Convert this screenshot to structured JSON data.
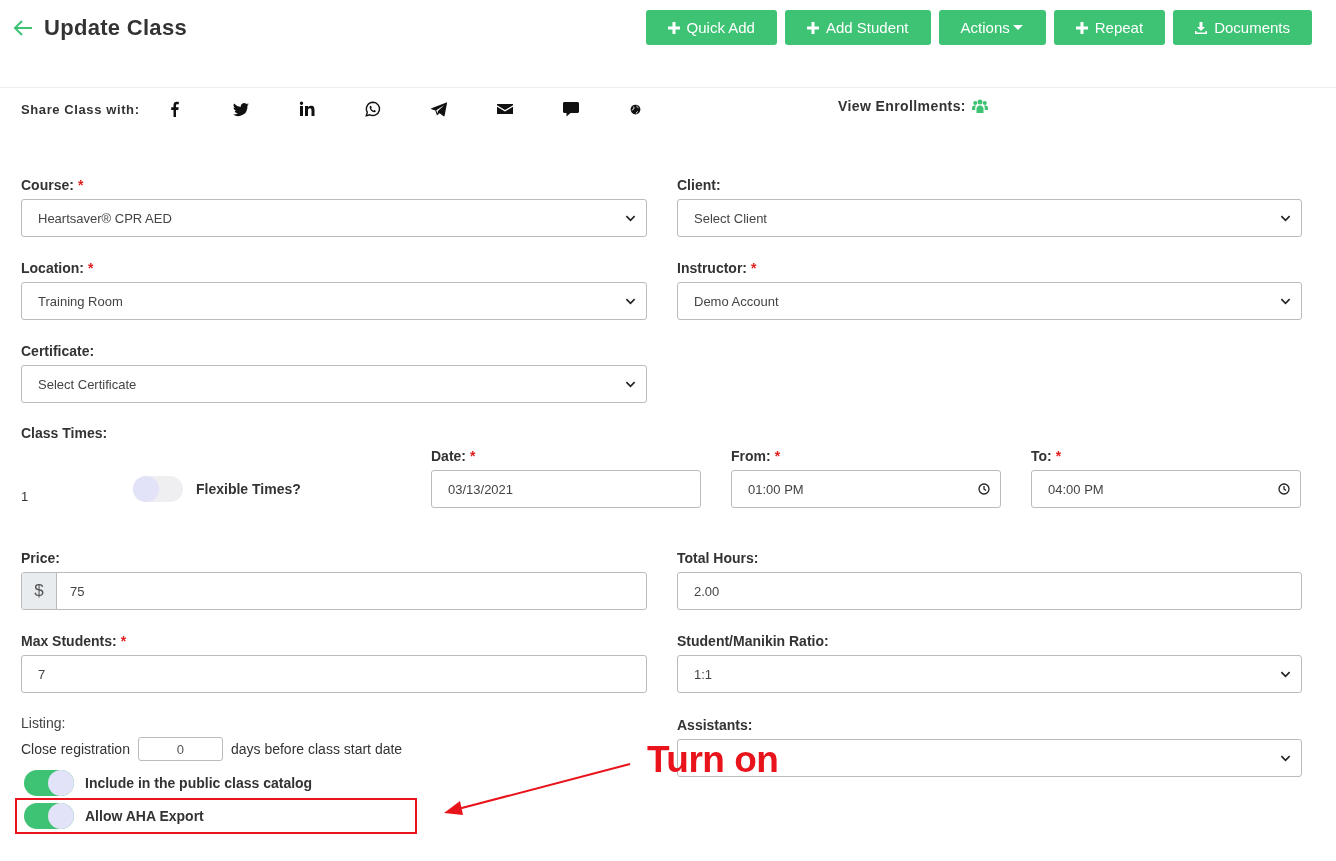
{
  "header": {
    "title": "Update Class",
    "buttons": [
      {
        "label": "Quick Add",
        "kind": "add"
      },
      {
        "label": "Add Student",
        "kind": "add"
      },
      {
        "label": "Actions",
        "kind": "dropdown"
      },
      {
        "label": "Repeat",
        "kind": "add"
      },
      {
        "label": "Documents",
        "kind": "download"
      }
    ]
  },
  "share": {
    "label": "Share Class with:",
    "services": [
      {
        "kind": "facebook"
      },
      {
        "kind": "twitter"
      },
      {
        "kind": "linkedin"
      },
      {
        "kind": "whatsapp"
      },
      {
        "kind": "telegram"
      },
      {
        "kind": "email"
      },
      {
        "kind": "comment"
      },
      {
        "kind": "globe"
      }
    ]
  },
  "enrollments": {
    "label": "View Enrollments:"
  },
  "rows_top": [
    [
      {
        "label": "Course:",
        "required_mark": "*",
        "kind": "select",
        "value": "Heartsaver® CPR AED"
      },
      {
        "label": "Client:",
        "kind": "select",
        "value": "Select Client"
      }
    ],
    [
      {
        "label": "Location:",
        "required_mark": "*",
        "kind": "select",
        "value": "Training Room"
      },
      {
        "label": "Instructor:",
        "required_mark": "*",
        "kind": "select",
        "value": "Demo Account"
      }
    ],
    [
      {
        "label": "Certificate:",
        "kind": "select",
        "value": "Select Certificate"
      }
    ]
  ],
  "class_times": {
    "label": "Class Times:",
    "index": "1",
    "flexible": {
      "label": "Flexible Times?",
      "on": false
    },
    "fields": [
      {
        "label": "Date:",
        "required_mark": "*",
        "kind": "text",
        "value": "03/13/2021"
      },
      {
        "label": "From:",
        "required_mark": "*",
        "kind": "time",
        "value": "01:00 PM"
      },
      {
        "label": "To:",
        "required_mark": "*",
        "kind": "time",
        "value": "04:00 PM"
      }
    ]
  },
  "rows_bottom": [
    [
      {
        "label": "Price:",
        "kind": "prefixed",
        "prefix": "$",
        "value": "75"
      },
      {
        "label": "Total Hours:",
        "kind": "text",
        "value": "2.00"
      }
    ],
    [
      {
        "label": "Max Students:",
        "required_mark": "*",
        "kind": "text",
        "value": "7"
      },
      {
        "label": "Student/Manikin Ratio:",
        "kind": "select",
        "value": "1:1"
      }
    ]
  ],
  "listing": {
    "label": "Listing:",
    "close_before": "Close registration",
    "days": "0",
    "close_after": "days before class start date",
    "toggles": [
      {
        "label": "Include in the public class catalog",
        "on": true,
        "highlighted": false
      },
      {
        "label": "Allow AHA Export",
        "on": true,
        "highlighted": true
      }
    ]
  },
  "assistants": {
    "label": "Assistants:",
    "kind": "select"
  },
  "annotation": {
    "text": "Turn on"
  }
}
